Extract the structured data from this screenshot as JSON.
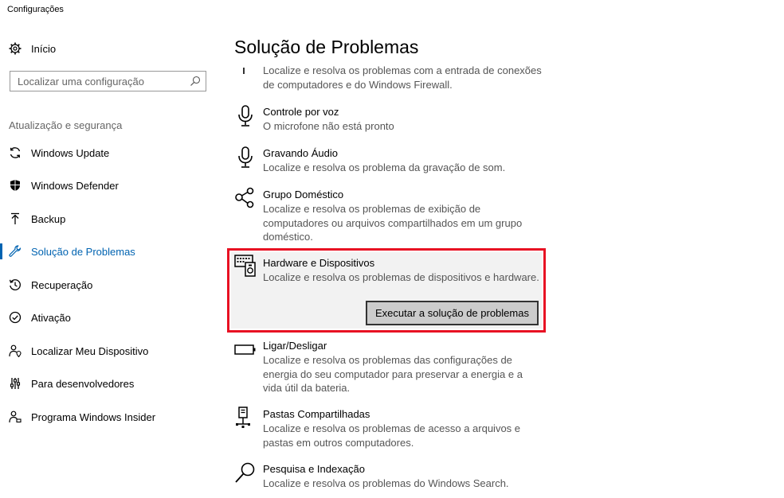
{
  "window": {
    "title": "Configurações"
  },
  "sidebar": {
    "home_label": "Início",
    "search_placeholder": "Localizar uma configuração",
    "section_label": "Atualização e segurança",
    "items": [
      {
        "label": "Windows Update",
        "icon": "refresh-icon"
      },
      {
        "label": "Windows Defender",
        "icon": "shield-icon"
      },
      {
        "label": "Backup",
        "icon": "backup-arrow-icon"
      },
      {
        "label": "Solução de Problemas",
        "icon": "wrench-icon",
        "active": true
      },
      {
        "label": "Recuperação",
        "icon": "history-icon"
      },
      {
        "label": "Ativação",
        "icon": "check-circle-icon"
      },
      {
        "label": "Localizar Meu Dispositivo",
        "icon": "person-location-icon"
      },
      {
        "label": "Para desenvolvedores",
        "icon": "developer-sliders-icon"
      },
      {
        "label": "Programa Windows Insider",
        "icon": "insider-person-icon"
      }
    ]
  },
  "main": {
    "title": "Solução de Problemas",
    "entries": [
      {
        "title": "",
        "desc": "Localize e resolva os problemas com a entrada de conexões de computadores e do Windows Firewall.",
        "icon": "firewall-icon"
      },
      {
        "title": "Controle por voz",
        "desc": "O microfone não está pronto",
        "icon": "microphone-icon"
      },
      {
        "title": "Gravando Áudio",
        "desc": "Localize e resolva os problema da gravação de som.",
        "icon": "microphone-icon"
      },
      {
        "title": "Grupo Doméstico",
        "desc": "Localize e resolva os problemas de exibição de computadores ou arquivos compartilhados em um grupo doméstico.",
        "icon": "homegroup-icon"
      },
      {
        "title": "Hardware e Dispositivos",
        "desc": "Localize e resolva os problemas de dispositivos e hardware.",
        "icon": "hardware-devices-icon",
        "selected": true,
        "button_label": "Executar a solução de problemas"
      },
      {
        "title": "Ligar/Desligar",
        "desc": "Localize e resolva os problemas das configurações de energia do seu computador para preservar a energia e a vida útil da bateria.",
        "icon": "battery-icon"
      },
      {
        "title": "Pastas Compartilhadas",
        "desc": "Localize e resolva os problemas de acesso a arquivos e pastas em outros computadores.",
        "icon": "shared-folders-icon"
      },
      {
        "title": "Pesquisa e Indexação",
        "desc": "Localize e resolva os problemas do Windows Search.",
        "icon": "search-icon"
      }
    ]
  },
  "colors": {
    "accent": "#0063b1",
    "highlight_border": "#e81123"
  }
}
